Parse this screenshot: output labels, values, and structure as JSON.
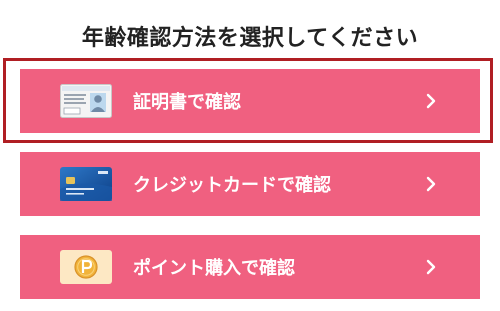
{
  "page": {
    "title": "年齢確認方法を選択してください"
  },
  "options": [
    {
      "label": "証明書で確認",
      "icon": "id-card-icon",
      "selected": true
    },
    {
      "label": "クレジットカードで確認",
      "icon": "credit-card-icon",
      "selected": false
    },
    {
      "label": "ポイント購入で確認",
      "icon": "point-coin-icon",
      "selected": false
    }
  ],
  "colors": {
    "button_bg": "#f06080",
    "highlight_border": "#b01e23",
    "title_text": "#222222"
  }
}
